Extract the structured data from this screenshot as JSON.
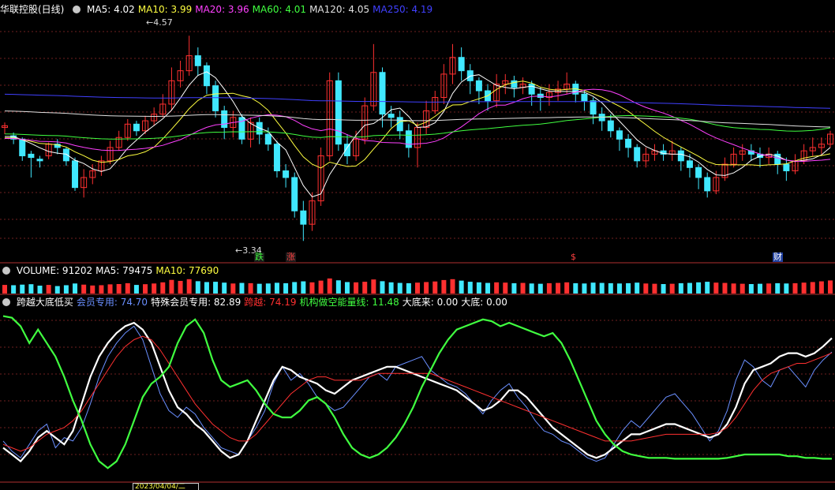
{
  "main_panel": {
    "title": "华联控股(日线)",
    "indicators": [
      {
        "label": "MA5: 4.02",
        "color": "#ffffff"
      },
      {
        "label": "MA10: 3.99",
        "color": "#ffff40"
      },
      {
        "label": "MA20: 3.96",
        "color": "#ff40ff"
      },
      {
        "label": "MA60: 4.01",
        "color": "#40ff40"
      },
      {
        "label": "MA120: 4.05",
        "color": "#e0e0e0"
      },
      {
        "label": "MA250: 4.19",
        "color": "#4040ff"
      }
    ],
    "high_label": "4.57",
    "low_label": "3.34",
    "markers": [
      {
        "text": "跌",
        "color": "#40ff40",
        "bg": "#1a1a1a"
      },
      {
        "text": "涨",
        "color": "#ff4040",
        "bg": "#1a1a1a"
      },
      {
        "text": "$",
        "color": "#ff4040",
        "bg": "#000000"
      },
      {
        "text": "财",
        "color": "#ffffff",
        "bg": "#2040a0"
      }
    ]
  },
  "volume_panel": {
    "indicators": [
      {
        "label": "VOLUME: 91202",
        "color": "#ffffff"
      },
      {
        "label": "MA5: 79475",
        "color": "#ffffff"
      },
      {
        "label": "MA10: 77690",
        "color": "#ffff40"
      }
    ]
  },
  "indicator_panel": {
    "indicators": [
      {
        "label": "跨越大底低买",
        "color": "#ffffff"
      },
      {
        "label": "会员专用: 74.70",
        "color": "#6a8fff"
      },
      {
        "label": "特殊会员专用: 82.89",
        "color": "#ffffff"
      },
      {
        "label": "跨越: 74.19",
        "color": "#ff3030"
      },
      {
        "label": "机构做空能量线: 11.48",
        "color": "#40ff40"
      },
      {
        "label": "大底来: 0.00",
        "color": "#ffffff"
      },
      {
        "label": "大底: 0.00",
        "color": "#ffffff"
      }
    ]
  },
  "date_label": "2023/04/04/二",
  "chart_data": [
    {
      "type": "candlestick",
      "title": "华联控股(日线)",
      "ylim": [
        3.28,
        4.68
      ],
      "high": 4.57,
      "low": 3.34,
      "ohlc_series": "daily",
      "candles": [
        [
          4.02,
          4.03,
          4.05,
          3.98
        ],
        [
          3.97,
          3.95,
          3.99,
          3.92
        ],
        [
          3.95,
          3.85,
          3.96,
          3.82
        ],
        [
          3.86,
          3.84,
          3.88,
          3.72
        ],
        [
          3.83,
          3.82,
          3.85,
          3.78
        ],
        [
          3.85,
          3.92,
          3.93,
          3.83
        ],
        [
          3.92,
          3.9,
          3.95,
          3.86
        ],
        [
          3.89,
          3.82,
          3.9,
          3.79
        ],
        [
          3.82,
          3.66,
          3.84,
          3.64
        ],
        [
          3.66,
          3.72,
          3.77,
          3.6
        ],
        [
          3.72,
          3.76,
          3.8,
          3.68
        ],
        [
          3.76,
          3.82,
          3.85,
          3.73
        ],
        [
          3.82,
          3.9,
          3.94,
          3.8
        ],
        [
          3.9,
          3.96,
          4.0,
          3.88
        ],
        [
          3.96,
          4.04,
          4.07,
          3.94
        ],
        [
          4.04,
          4.0,
          4.06,
          3.97
        ],
        [
          4.0,
          4.06,
          4.09,
          3.98
        ],
        [
          4.06,
          4.1,
          4.14,
          4.03
        ],
        [
          4.1,
          4.16,
          4.22,
          4.08
        ],
        [
          4.16,
          4.3,
          4.38,
          4.12
        ],
        [
          4.3,
          4.36,
          4.42,
          4.26
        ],
        [
          4.36,
          4.45,
          4.57,
          4.33
        ],
        [
          4.45,
          4.39,
          4.5,
          4.33
        ],
        [
          4.39,
          4.27,
          4.41,
          4.22
        ],
        [
          4.27,
          4.12,
          4.3,
          4.08
        ],
        [
          4.12,
          4.02,
          4.15,
          3.95
        ],
        [
          4.02,
          4.08,
          4.12,
          3.96
        ],
        [
          4.08,
          3.95,
          4.1,
          3.92
        ],
        [
          3.95,
          4.05,
          4.08,
          3.9
        ],
        [
          4.05,
          3.98,
          4.08,
          3.92
        ],
        [
          3.98,
          3.92,
          4.02,
          3.88
        ],
        [
          3.92,
          3.76,
          3.94,
          3.72
        ],
        [
          3.76,
          3.72,
          3.8,
          3.66
        ],
        [
          3.72,
          3.52,
          3.75,
          3.48
        ],
        [
          3.52,
          3.44,
          3.58,
          3.34
        ],
        [
          3.44,
          3.58,
          3.63,
          3.4
        ],
        [
          3.58,
          3.85,
          3.9,
          3.55
        ],
        [
          3.85,
          4.3,
          4.35,
          3.82
        ],
        [
          4.3,
          3.92,
          4.35,
          3.88
        ],
        [
          3.92,
          3.85,
          3.98,
          3.8
        ],
        [
          3.85,
          3.95,
          4.0,
          3.82
        ],
        [
          3.95,
          4.15,
          4.2,
          3.92
        ],
        [
          4.15,
          4.35,
          4.52,
          4.12
        ],
        [
          4.35,
          4.1,
          4.38,
          4.02
        ],
        [
          4.1,
          4.08,
          4.15,
          4.02
        ],
        [
          4.08,
          4.0,
          4.12,
          3.95
        ],
        [
          4.0,
          3.9,
          4.04,
          3.84
        ],
        [
          3.9,
          4.02,
          4.05,
          3.78
        ],
        [
          4.02,
          4.12,
          4.18,
          3.98
        ],
        [
          4.12,
          4.2,
          4.24,
          4.1
        ],
        [
          4.2,
          4.34,
          4.4,
          4.16
        ],
        [
          4.34,
          4.44,
          4.52,
          4.28
        ],
        [
          4.44,
          4.36,
          4.5,
          4.3
        ],
        [
          4.36,
          4.3,
          4.4,
          4.22
        ],
        [
          4.3,
          4.24,
          4.32,
          4.16
        ],
        [
          4.24,
          4.18,
          4.28,
          4.12
        ],
        [
          4.18,
          4.28,
          4.34,
          4.14
        ],
        [
          4.28,
          4.3,
          4.34,
          4.22
        ],
        [
          4.3,
          4.26,
          4.33,
          4.2
        ],
        [
          4.26,
          4.28,
          4.32,
          4.22
        ],
        [
          4.28,
          4.22,
          4.3,
          4.15
        ],
        [
          4.22,
          4.2,
          4.26,
          4.12
        ],
        [
          4.2,
          4.23,
          4.28,
          4.15
        ],
        [
          4.23,
          4.25,
          4.3,
          4.18
        ],
        [
          4.25,
          4.28,
          4.35,
          4.22
        ],
        [
          4.28,
          4.22,
          4.3,
          4.17
        ],
        [
          4.22,
          4.18,
          4.24,
          4.12
        ],
        [
          4.18,
          4.1,
          4.2,
          4.04
        ],
        [
          4.1,
          4.06,
          4.14,
          4.0
        ],
        [
          4.06,
          4.0,
          4.1,
          3.96
        ],
        [
          4.0,
          3.95,
          4.02,
          3.88
        ],
        [
          3.95,
          3.9,
          3.98,
          3.84
        ],
        [
          3.9,
          3.82,
          3.92,
          3.78
        ],
        [
          3.82,
          3.86,
          3.9,
          3.78
        ],
        [
          3.86,
          3.88,
          3.92,
          3.82
        ],
        [
          3.88,
          3.86,
          3.92,
          3.82
        ],
        [
          3.86,
          3.88,
          3.94,
          3.82
        ],
        [
          3.88,
          3.82,
          3.9,
          3.76
        ],
        [
          3.82,
          3.78,
          3.86,
          3.72
        ],
        [
          3.78,
          3.72,
          3.8,
          3.65
        ],
        [
          3.72,
          3.64,
          3.75,
          3.6
        ],
        [
          3.64,
          3.72,
          3.76,
          3.62
        ],
        [
          3.72,
          3.8,
          3.84,
          3.7
        ],
        [
          3.8,
          3.86,
          3.9,
          3.78
        ],
        [
          3.86,
          3.88,
          3.92,
          3.82
        ],
        [
          3.88,
          3.86,
          3.92,
          3.82
        ],
        [
          3.86,
          3.84,
          3.9,
          3.78
        ],
        [
          3.84,
          3.86,
          3.9,
          3.8
        ],
        [
          3.86,
          3.8,
          3.88,
          3.74
        ],
        [
          3.8,
          3.76,
          3.84,
          3.7
        ],
        [
          3.76,
          3.82,
          3.86,
          3.74
        ],
        [
          3.82,
          3.88,
          3.92,
          3.8
        ],
        [
          3.88,
          3.9,
          3.96,
          3.85
        ],
        [
          3.9,
          3.92,
          3.96,
          3.86
        ],
        [
          3.92,
          3.98,
          4.0,
          3.9
        ]
      ],
      "series": [
        {
          "name": "MA5",
          "color": "#ffffff"
        },
        {
          "name": "MA10",
          "color": "#ffff40"
        },
        {
          "name": "MA20",
          "color": "#ff40ff"
        },
        {
          "name": "MA60",
          "color": "#40ff40"
        },
        {
          "name": "MA120",
          "color": "#e0e0e0"
        },
        {
          "name": "MA250",
          "color": "#4040ff"
        }
      ]
    },
    {
      "type": "bar",
      "title": "VOLUME",
      "ylim": [
        0,
        110000
      ],
      "values": [
        60000,
        58000,
        62000,
        65000,
        55000,
        60000,
        52000,
        58000,
        70000,
        62000,
        56000,
        58000,
        64000,
        66000,
        72000,
        60000,
        65000,
        70000,
        78000,
        95000,
        88000,
        100000,
        86000,
        80000,
        82000,
        76000,
        70000,
        74000,
        72000,
        68000,
        70000,
        75000,
        72000,
        80000,
        85000,
        78000,
        90000,
        105000,
        92000,
        80000,
        78000,
        82000,
        98000,
        86000,
        78000,
        74000,
        72000,
        76000,
        80000,
        84000,
        94000,
        100000,
        90000,
        82000,
        78000,
        74000,
        78000,
        76000,
        72000,
        74000,
        70000,
        68000,
        72000,
        74000,
        78000,
        72000,
        70000,
        76000,
        74000,
        72000,
        70000,
        72000,
        76000,
        70000,
        68000,
        66000,
        68000,
        72000,
        74000,
        78000,
        82000,
        76000,
        74000,
        70000,
        68000,
        66000,
        68000,
        70000,
        72000,
        70000,
        72000,
        76000,
        80000,
        85000,
        91202
      ]
    },
    {
      "type": "line",
      "title": "跨越大底低买",
      "ylim": [
        0,
        100
      ],
      "series": [
        {
          "name": "会员专用",
          "color": "#6a8fff",
          "values": [
            22,
            16,
            12,
            20,
            28,
            32,
            18,
            24,
            22,
            30,
            44,
            60,
            72,
            80,
            86,
            90,
            82,
            66,
            50,
            40,
            36,
            42,
            38,
            30,
            24,
            18,
            16,
            14,
            22,
            30,
            40,
            56,
            66,
            58,
            62,
            56,
            48,
            44,
            40,
            42,
            48,
            54,
            60,
            62,
            58,
            66,
            68,
            70,
            72,
            64,
            60,
            56,
            54,
            50,
            44,
            38,
            46,
            52,
            56,
            48,
            42,
            34,
            28,
            26,
            22,
            20,
            16,
            12,
            10,
            12,
            20,
            28,
            34,
            30,
            36,
            42,
            48,
            50,
            44,
            38,
            30,
            22,
            28,
            40,
            58,
            70,
            66,
            58,
            54,
            64,
            66,
            60,
            54,
            64,
            70,
            74.7
          ]
        },
        {
          "name": "特殊会员专用",
          "color": "#ffffff",
          "values": [
            18,
            14,
            10,
            16,
            24,
            28,
            24,
            20,
            28,
            44,
            60,
            72,
            80,
            86,
            90,
            92,
            88,
            80,
            66,
            52,
            42,
            38,
            32,
            28,
            22,
            16,
            12,
            14,
            22,
            34,
            46,
            58,
            66,
            64,
            60,
            58,
            56,
            52,
            50,
            54,
            58,
            60,
            62,
            64,
            66,
            66,
            64,
            62,
            60,
            58,
            56,
            54,
            52,
            48,
            44,
            40,
            42,
            46,
            52,
            52,
            48,
            42,
            36,
            30,
            26,
            22,
            18,
            14,
            12,
            14,
            18,
            22,
            26,
            26,
            28,
            30,
            32,
            32,
            30,
            28,
            26,
            24,
            26,
            32,
            42,
            56,
            64,
            66,
            68,
            72,
            74,
            74,
            72,
            74,
            78,
            82.89
          ]
        },
        {
          "name": "跨越",
          "color": "#ff3030",
          "values": [
            20,
            18,
            16,
            18,
            22,
            26,
            28,
            30,
            34,
            40,
            48,
            56,
            64,
            72,
            78,
            82,
            84,
            82,
            76,
            68,
            60,
            52,
            44,
            38,
            32,
            28,
            24,
            22,
            22,
            26,
            32,
            38,
            44,
            50,
            54,
            58,
            60,
            60,
            58,
            58,
            58,
            58,
            60,
            62,
            62,
            62,
            62,
            62,
            62,
            62,
            60,
            58,
            56,
            54,
            52,
            50,
            48,
            46,
            44,
            42,
            40,
            38,
            36,
            34,
            32,
            30,
            28,
            26,
            24,
            22,
            22,
            22,
            22,
            23,
            24,
            25,
            26,
            26,
            26,
            26,
            26,
            26,
            27,
            30,
            36,
            44,
            52,
            58,
            62,
            64,
            66,
            68,
            68,
            70,
            72,
            74.19
          ]
        },
        {
          "name": "机构做空能量线",
          "color": "#40ff40",
          "values": [
            96,
            95,
            90,
            80,
            88,
            80,
            72,
            60,
            46,
            34,
            20,
            10,
            6,
            10,
            20,
            34,
            48,
            56,
            60,
            66,
            80,
            90,
            94,
            86,
            70,
            58,
            54,
            56,
            58,
            52,
            44,
            38,
            36,
            36,
            40,
            46,
            48,
            44,
            36,
            26,
            18,
            14,
            12,
            14,
            18,
            24,
            32,
            42,
            54,
            64,
            74,
            82,
            88,
            90,
            92,
            94,
            93,
            90,
            92,
            90,
            88,
            86,
            84,
            86,
            80,
            70,
            58,
            46,
            34,
            26,
            20,
            16,
            14,
            13,
            12,
            12,
            12,
            11.5,
            11.5,
            11.5,
            11.48,
            11.5,
            11.5,
            12,
            13,
            14,
            14,
            14,
            14,
            14,
            13,
            13,
            12,
            12,
            11.5,
            11.48
          ]
        }
      ]
    }
  ]
}
